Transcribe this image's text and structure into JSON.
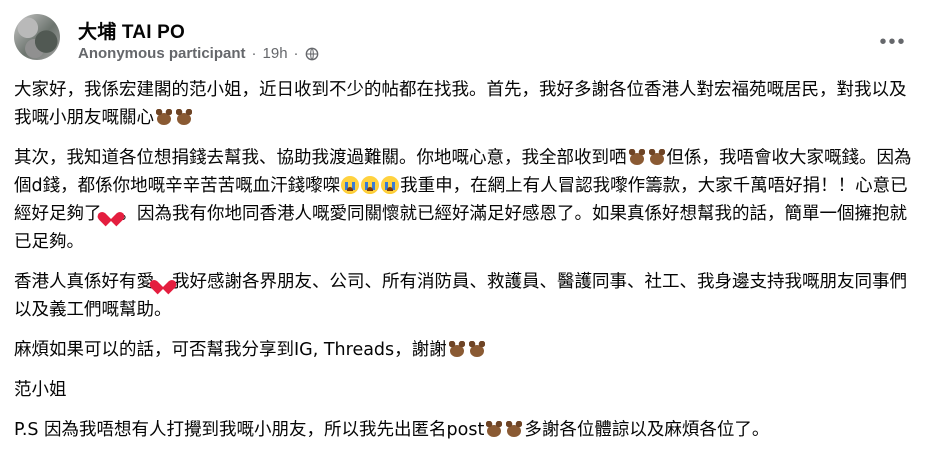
{
  "group": {
    "name": "大埔 TAI PO"
  },
  "post": {
    "author": "Anonymous participant",
    "separator": "·",
    "time": "19h",
    "separator2": "·",
    "privacy_icon": "globe-icon",
    "more_icon": "more-options-icon",
    "paragraphs": [
      [
        "大家好，我係宏建閣的范小姐，近日收到不少的帖都在找我。首先，我好多謝各位香港人對宏福苑嘅居民，對我以及我嘅小朋友嘅關心",
        "[bear]",
        "[bear]"
      ],
      [
        "其次，我知道各位想捐錢去幫我、協助我渡過難關。你地嘅心意，我全部收到哂",
        "[bear]",
        "[bear]",
        "但係，我唔會收大家嘅錢。因為個d錢，都係你地嘅辛辛苦苦嘅血汗錢嚟㗎",
        "[cry]",
        "[cry]",
        "[cry]",
        "我重申，在網上有人冒認我嚟作籌款，大家千萬唔好捐！！心意已經好足夠了",
        "[heart]",
        "。因為我有你地同香港人嘅愛同關懷就已經好滿足好感恩了。如果真係好想幫我的話，簡單一個擁抱就已足夠。"
      ],
      [
        "香港人真係好有愛",
        "[heart]",
        "我好感謝各界朋友、公司、所有消防員、救護員、醫護同事、社工、我身邊支持我嘅朋友同事們以及義工們嘅幫助。"
      ],
      [
        "麻煩如果可以的話，可否幫我分享到IG, Threads，謝謝",
        "[bear]",
        "[bear]"
      ],
      [
        "范小姐"
      ],
      [
        "P.S 因為我唔想有人打攪到我嘅小朋友，所以我先出匿名post",
        "[bear]",
        "[bear]",
        "多謝各位體諒以及麻煩各位了。"
      ]
    ]
  }
}
